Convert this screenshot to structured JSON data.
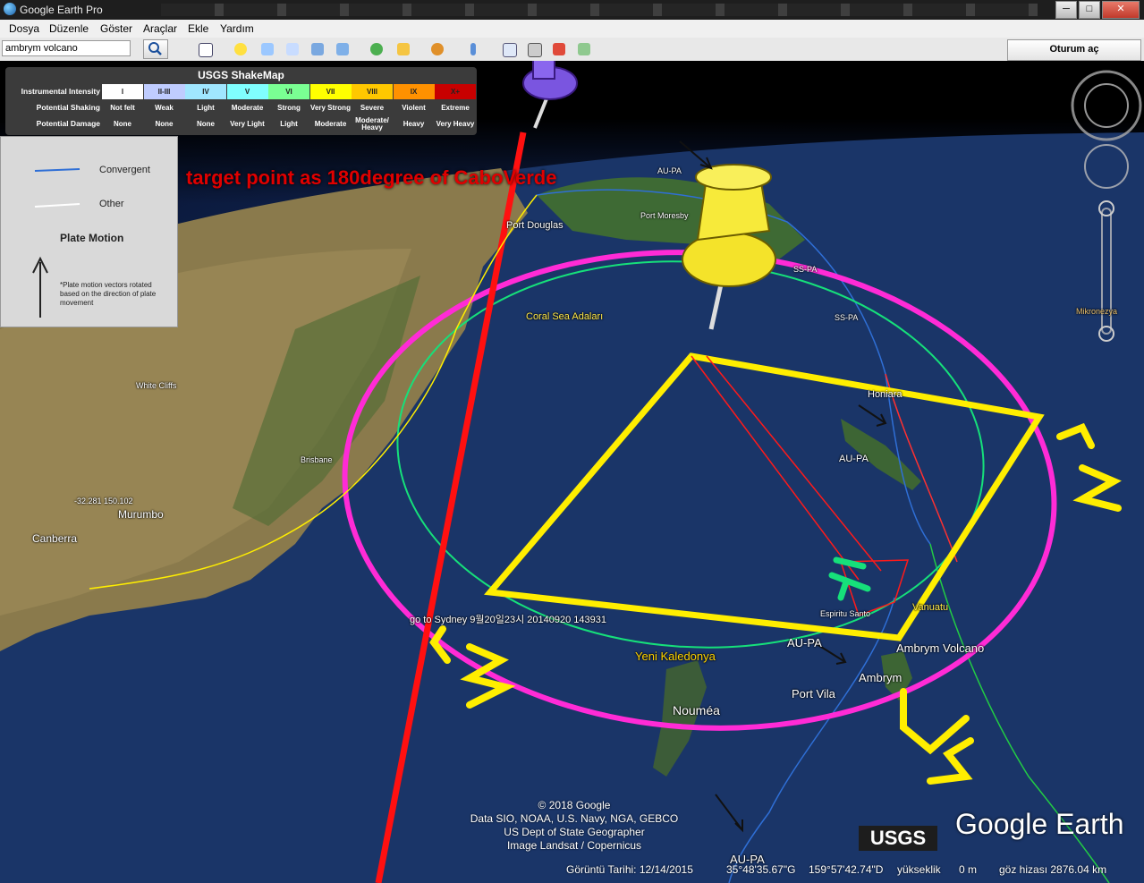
{
  "window": {
    "title": "Google Earth Pro",
    "minimize": "─",
    "maximize": "□",
    "close": "✕"
  },
  "menu": [
    "Dosya",
    "Düzenle",
    "Göster",
    "Araçlar",
    "Ekle",
    "Yardım"
  ],
  "search": {
    "value": "ambrym volcano"
  },
  "toolbar": {
    "login_label": "Oturum aç"
  },
  "shakemap": {
    "title": "USGS ShakeMap",
    "row_labels": [
      "Instrumental Intensity",
      "Potential Shaking",
      "Potential Damage"
    ],
    "columns": [
      {
        "intensity": "I",
        "shaking": "Not felt",
        "damage": "None",
        "color": "#ffffff"
      },
      {
        "intensity": "II-III",
        "shaking": "Weak",
        "damage": "None",
        "color": "#bfccff"
      },
      {
        "intensity": "IV",
        "shaking": "Light",
        "damage": "None",
        "color": "#a0e6ff"
      },
      {
        "intensity": "V",
        "shaking": "Moderate",
        "damage": "Very Light",
        "color": "#80ffff"
      },
      {
        "intensity": "VI",
        "shaking": "Strong",
        "damage": "Light",
        "color": "#7aff93"
      },
      {
        "intensity": "VII",
        "shaking": "Very Strong",
        "damage": "Moderate",
        "color": "#ffff00"
      },
      {
        "intensity": "VIII",
        "shaking": "Severe",
        "damage": "Moderate/ Heavy",
        "color": "#ffc800"
      },
      {
        "intensity": "IX",
        "shaking": "Violent",
        "damage": "Heavy",
        "color": "#ff9100"
      },
      {
        "intensity": "X+",
        "shaking": "Extreme",
        "damage": "Very Heavy",
        "color": "#c80000"
      }
    ]
  },
  "plate_legend": {
    "convergent": "Convergent",
    "other": "Other",
    "plate_motion": "Plate Motion",
    "note": "*Plate motion vectors rotated based on the direction of plate movement",
    "convergent_color": "#2f6fd6",
    "other_color": "#ffffff"
  },
  "annotation": "target point as 180degree of CaboVerde",
  "labels": {
    "port_douglas": "Port Douglas",
    "port_moresby": "Port Moresby",
    "coral_sea": "Coral Sea Adaları",
    "honiara": "Honiara",
    "au_pa_1": "AU-PA",
    "au_pa_2": "AU-PA",
    "au_pa_3": "AU-PA",
    "au_pa_4": "AU-PA",
    "ss_pa_1": "SS-PA",
    "ss_pa_2": "SS-PA",
    "espiritu": "Espiritu Santo",
    "vanuatu": "Vanuatu",
    "ambrym_volcano": "Ambrym Volcano",
    "ambrym": "Ambrym",
    "port_vila": "Port Vila",
    "yeni_kaledonya": "Yeni Kaledonya",
    "noumea": "Nouméa",
    "murumbo": "Murumbo",
    "canberra": "Canberra",
    "brisbane": "Brisbane",
    "white_cliffs": "White Cliffs",
    "coords": "-32.281 150.102",
    "go_to_sydney": "go to Sydney 9월20일23시 20140920 143931",
    "mikronezya": "Mikronezya"
  },
  "copyright": [
    "© 2018 Google",
    "Data SIO, NOAA, U.S. Navy, NGA, GEBCO",
    "US Dept of State Geographer",
    "Image Landsat / Copernicus"
  ],
  "brand": "Google Earth",
  "usgs_logo": "USGS",
  "status": {
    "date_label": "Görüntü Tarihi: 12/14/2015",
    "lat": "35°48'35.67\"G",
    "lon": "159°57'42.74\"D",
    "elev_label": "yükseklik",
    "elev_value": "0 m",
    "eye_alt": "göz hizası 2876.04 km"
  },
  "handwritten": [
    "1",
    "2",
    "3",
    "4",
    "5"
  ],
  "overlay_colors": {
    "magenta": "#ff2bd6",
    "yellow": "#ffee00",
    "red": "#ff1a1a",
    "green": "#16e07a"
  }
}
